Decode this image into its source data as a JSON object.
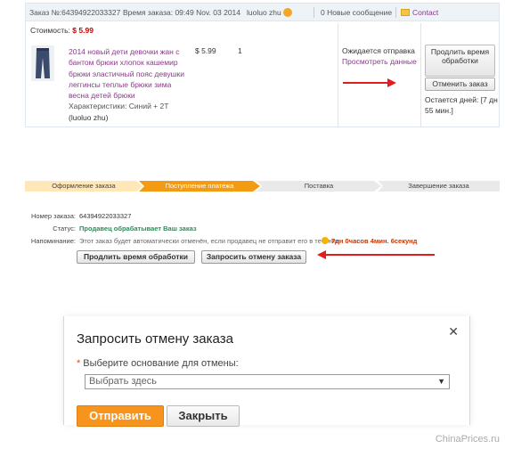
{
  "order": {
    "header": {
      "order_no": "Заказ №:64394922033327",
      "order_time": "Время заказа: 09:49 Nov. 03 2014",
      "seller": "luoluo zhu",
      "messages": "0 Новые сообщение",
      "contact": "Contact"
    },
    "cost_label": "Стоимость:",
    "cost_value": "$ 5.99",
    "product": {
      "title": "2014 новый дети девочки жан с бантом брюки хлопок кашемир брюки эластичный пояс девушки леггинсы теплые брюки зима весна детей брюки",
      "attributes": "Характеристики: Синий  + 2T",
      "seller": "(luoluo zhu)",
      "price": "$ 5.99",
      "qty": "1"
    },
    "status_text": "Ожидается отправка",
    "status_link": "Просмотреть данные",
    "extend_button": "Продлить время обработки",
    "cancel_button": "Отменить заказ",
    "days_left": "Остается дней: [7 дн 55 мин.]"
  },
  "progress": {
    "steps": [
      "Оформление заказа",
      "Поступление платежа",
      "Поставка",
      "Завершение заказа"
    ],
    "active_index": 1
  },
  "details": {
    "order_no_label": "Номер заказа:",
    "order_no_value": "64394922033327",
    "status_label": "Статус:",
    "status_value": "Продавец обрабатывает Ваш заказ",
    "reminder_label": "Напоминание:",
    "reminder_text": "Этот заказ будет автоматически отменён, если продавец не отправит его в течение:",
    "timer": "7дн 0часов 4мин. 6секунд",
    "extend_button": "Продлить время обработки",
    "request_cancel_button": "Запросить отмену заказа"
  },
  "dialog": {
    "title": "Запросить отмену заказа",
    "close_symbol": "✕",
    "reason_label": "Выберите основание для отмены:",
    "select_placeholder": "Выбрать здесь",
    "send_button": "Отправить",
    "close_button": "Закрыть"
  },
  "watermark": "ChinaPrices.ru",
  "colors": {
    "accent": "#f7941d",
    "arrow": "#e31d1d",
    "price": "#cc0000",
    "link": "#8b3a8b",
    "status_green": "#2e8b57"
  }
}
